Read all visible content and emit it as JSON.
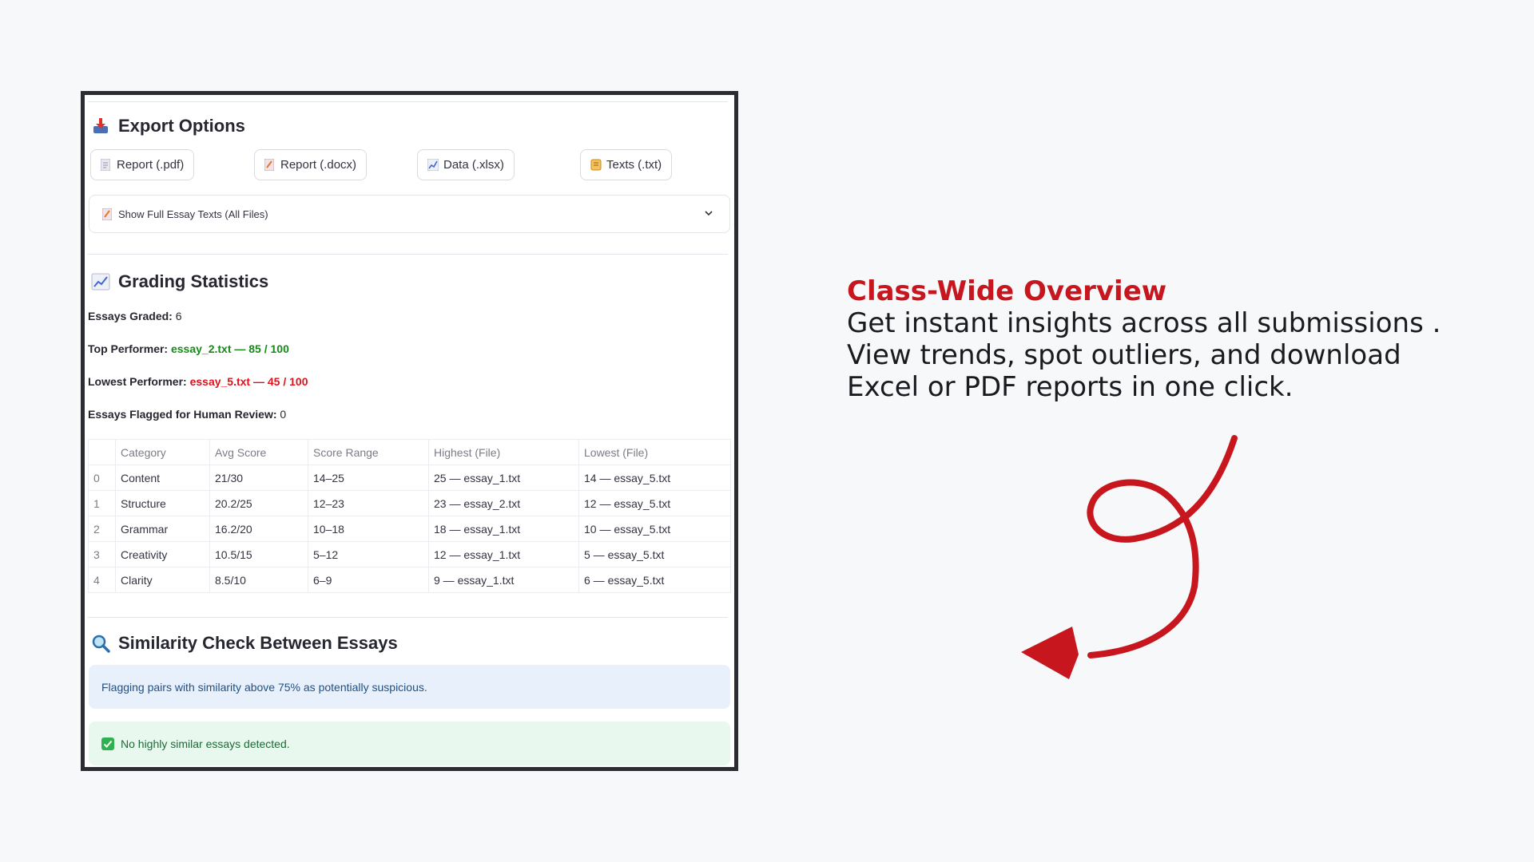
{
  "export": {
    "heading": "Export Options",
    "buttons": [
      {
        "label": "Report (.pdf)",
        "icon": "pdf-file-icon"
      },
      {
        "label": "Report (.docx)",
        "icon": "docx-file-icon"
      },
      {
        "label": "Data (.xlsx)",
        "icon": "chart-file-icon"
      },
      {
        "label": "Texts (.txt)",
        "icon": "scroll-icon"
      }
    ],
    "expander_label": "Show Full Essay Texts (All Files)"
  },
  "stats": {
    "heading": "Grading Statistics",
    "essays_graded_label": "Essays Graded:",
    "essays_graded_value": "6",
    "top_label": "Top Performer:",
    "top_value": "essay_2.txt — 85 / 100",
    "lowest_label": "Lowest Performer:",
    "lowest_value": "essay_5.txt — 45 / 100",
    "flagged_label": "Essays Flagged for Human Review:",
    "flagged_value": "0",
    "columns": [
      "",
      "Category",
      "Avg Score",
      "Score Range",
      "Highest (File)",
      "Lowest (File)"
    ],
    "rows": [
      [
        "0",
        "Content",
        "21/30",
        "14–25",
        "25 — essay_1.txt",
        "14 — essay_5.txt"
      ],
      [
        "1",
        "Structure",
        "20.2/25",
        "12–23",
        "23 — essay_2.txt",
        "12 — essay_5.txt"
      ],
      [
        "2",
        "Grammar",
        "16.2/20",
        "10–18",
        "18 — essay_1.txt",
        "10 — essay_5.txt"
      ],
      [
        "3",
        "Creativity",
        "10.5/15",
        "5–12",
        "12 — essay_1.txt",
        "5 — essay_5.txt"
      ],
      [
        "4",
        "Clarity",
        "8.5/10",
        "6–9",
        "9 — essay_1.txt",
        "6 — essay_5.txt"
      ]
    ]
  },
  "similarity": {
    "heading": "Similarity Check Between Essays",
    "info": "Flagging pairs with similarity above 75% as potentially suspicious.",
    "success": "No highly similar essays detected."
  },
  "overview": {
    "title": "Class-Wide Overview",
    "lines": [
      "Get instant insights across all submissions .",
      "View trends, spot outliers, and download",
      "Excel or PDF reports in one click."
    ]
  },
  "colors": {
    "accent_red": "#c7161d",
    "top_green": "#168a16",
    "lowest_red": "#e0121b",
    "info_bg": "#e8f1fb",
    "success_bg": "#e9f8ee"
  }
}
